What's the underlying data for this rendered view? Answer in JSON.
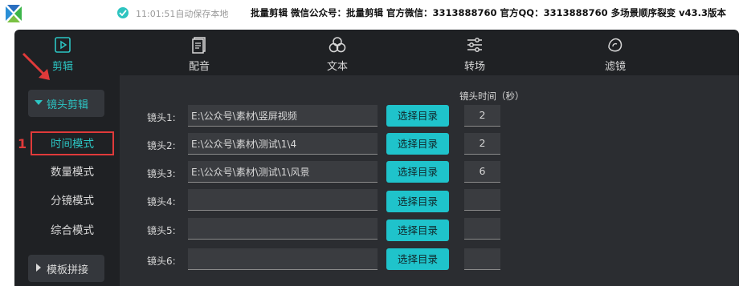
{
  "titlebar": {
    "save_status": "11:01:51自动保存本地",
    "info": "批量剪辑  微信公众号：批量剪辑  官方微信：3313888760  官方QQ：3313888760      多场景顺序裂变   v43.3版本"
  },
  "tabs": [
    {
      "label": "剪辑",
      "icon": "play-box-icon",
      "active": true
    },
    {
      "label": "配音",
      "icon": "document-icon",
      "active": false
    },
    {
      "label": "文本",
      "icon": "circles-icon",
      "active": false
    },
    {
      "label": "转场",
      "icon": "sliders-icon",
      "active": false
    },
    {
      "label": "滤镜",
      "icon": "filter-icon",
      "active": false
    }
  ],
  "sidebar": {
    "group_open": "镜头剪辑",
    "modes": [
      "时间模式",
      "数量模式",
      "分镜模式",
      "综合模式"
    ],
    "active_mode": "时间模式",
    "group_closed": "模板拼接"
  },
  "annotation": {
    "number": "1"
  },
  "table": {
    "seconds_header": "镜头时间（秒）",
    "pick_label": "选择目录",
    "rows": [
      {
        "label": "镜头1:",
        "path": "E:\\公众号\\素材\\竖屏视频",
        "seconds": "2"
      },
      {
        "label": "镜头2:",
        "path": "E:\\公众号\\素材\\测试\\1\\4",
        "seconds": "2"
      },
      {
        "label": "镜头3:",
        "path": "E:\\公众号\\素材\\测试\\1\\风景",
        "seconds": "6"
      },
      {
        "label": "镜头4:",
        "path": "",
        "seconds": ""
      },
      {
        "label": "镜头5:",
        "path": "",
        "seconds": ""
      },
      {
        "label": "镜头6:",
        "path": "",
        "seconds": ""
      }
    ]
  },
  "colors": {
    "accent": "#2cc6c4",
    "button": "#1fc3cb",
    "highlight": "#e03a3a"
  }
}
